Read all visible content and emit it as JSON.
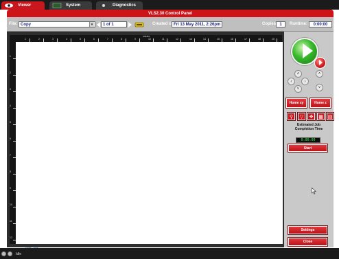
{
  "tabs": [
    {
      "label": "Viewer",
      "active": true
    },
    {
      "label": "System",
      "active": false
    },
    {
      "label": "Diagnostics",
      "active": false
    }
  ],
  "title": "VLS2.30  Control Panel",
  "toolbar": {
    "file_label": "File:",
    "file_value": "Copy",
    "page_value": "1 of 1",
    "created_label": "Created on:",
    "created_value": "Fri 13 May 2011,  2:26pm",
    "copies_label": "Copies:",
    "copies_value": "1",
    "runtime_label": "Runtime:",
    "runtime_value": "0:00:00"
  },
  "ruler": {
    "unit": "inches",
    "top_ticks": [
      "1",
      "2",
      "3",
      "4",
      "5",
      "6",
      "7",
      "8",
      "9",
      "10",
      "11",
      "12",
      "13",
      "14",
      "15",
      "16",
      "17",
      "18",
      "19",
      "20"
    ],
    "left_ticks": [
      "1",
      "2",
      "3",
      "4",
      "5",
      "6",
      "7",
      "8",
      "9",
      "10",
      "11",
      "12"
    ]
  },
  "zoom_text": "Zoom: 78%",
  "panel": {
    "home_xy_label": "Home xy",
    "home_z_label": "Home z",
    "est_label_line1": "Estimated Job",
    "est_label_line2": "Completion Time",
    "est_time": "0:00:00",
    "start_label": "Start",
    "settings_label": "Settings",
    "close_label": "Close"
  },
  "status": {
    "state": "Idle"
  },
  "colors": {
    "accent_red": "#cc1419",
    "go_green": "#39b92c",
    "timer_green": "#33ff44"
  }
}
